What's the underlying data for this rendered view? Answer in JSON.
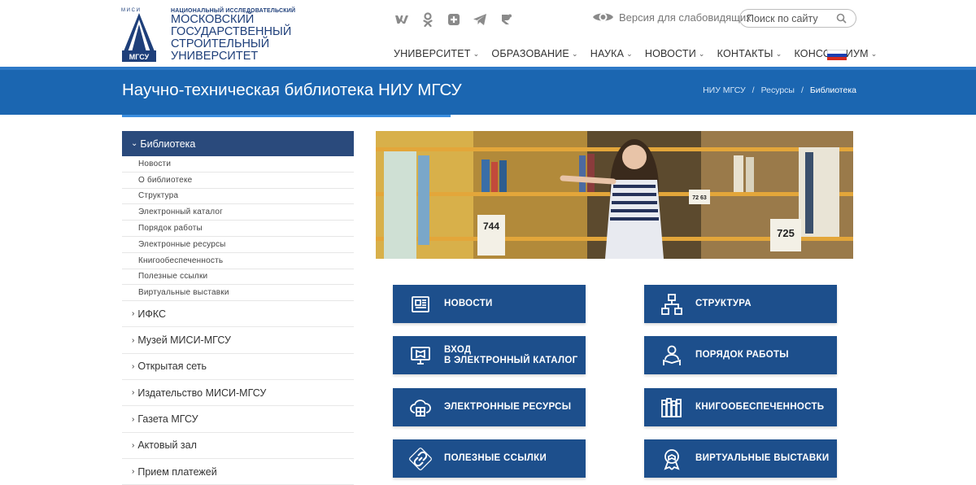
{
  "header": {
    "logo_abbr_top": "М И С И",
    "logo_abbr_bottom": "МГСУ",
    "logo_small": "НАЦИОНАЛЬНЫЙ ИССЛЕДОВАТЕЛЬСКИЙ",
    "logo_lines": [
      "МОСКОВСКИЙ",
      "ГОСУДАРСТВЕННЫЙ",
      "СТРОИТЕЛЬНЫЙ",
      "УНИВЕРСИТЕТ"
    ],
    "socials": [
      "vk-icon",
      "odnoklassniki-icon",
      "rutube-icon",
      "telegram-icon",
      "dzen-icon"
    ],
    "vision_label": "Версия для слабовидящих",
    "search_placeholder": "Поиск по сайту",
    "nav": [
      "УНИВЕРСИТЕТ",
      "ОБРАЗОВАНИЕ",
      "НАУКА",
      "НОВОСТИ",
      "КОНТАКТЫ",
      "КОНСОРЦИУМ"
    ],
    "flag_colors": [
      "#ffffff",
      "#1c3fb0",
      "#d52b1e"
    ]
  },
  "banner": {
    "title": "Научно-техническая библиотека НИУ МГСУ",
    "crumbs": [
      "НИУ МГСУ",
      "Ресурсы",
      "Библиотека"
    ],
    "separator": "/"
  },
  "sidebar": {
    "active": "Библиотека",
    "sub_items": [
      "Новости",
      "О библиотеке",
      "Структура",
      "Электронный каталог",
      "Порядок работы",
      "Электронные ресурсы",
      "Книгообеспеченность",
      "Полезные ссылки",
      "Виртуальные выставки"
    ],
    "sections": [
      "ИФКС",
      "Музей МИСИ-МГСУ",
      "Открытая сеть",
      "Издательство МИСИ-МГСУ",
      "Газета МГСУ",
      "Актовый зал",
      "Прием платежей"
    ]
  },
  "photo": {
    "shelf_labels": [
      "744",
      "725",
      "72 63"
    ]
  },
  "tiles": [
    {
      "line1": "НОВОСТИ",
      "line2": "",
      "icon": "newspaper-icon"
    },
    {
      "line1": "СТРУКТУРА",
      "line2": "",
      "icon": "hierarchy-icon"
    },
    {
      "line1": "ВХОД",
      "line2": "В ЭЛЕКТРОННЫЙ КАТАЛОГ",
      "icon": "monitor-book-icon"
    },
    {
      "line1": "ПОРЯДОК РАБОТЫ",
      "line2": "",
      "icon": "reader-icon"
    },
    {
      "line1": "ЭЛЕКТРОННЫЕ РЕСУРСЫ",
      "line2": "",
      "icon": "cloud-icon"
    },
    {
      "line1": "КНИГООБЕСПЕЧЕННОСТЬ",
      "line2": "",
      "icon": "books-icon"
    },
    {
      "line1": "ПОЛЕЗНЫЕ ССЫЛКИ",
      "line2": "",
      "icon": "link-icon"
    },
    {
      "line1": "ВИРТУАЛЬНЫЕ ВЫСТАВКИ",
      "line2": "",
      "icon": "award-book-icon"
    }
  ],
  "colors": {
    "banner": "#1b66b1",
    "tile": "#1d4f8c",
    "sidebar_active": "#2a4a7c"
  }
}
